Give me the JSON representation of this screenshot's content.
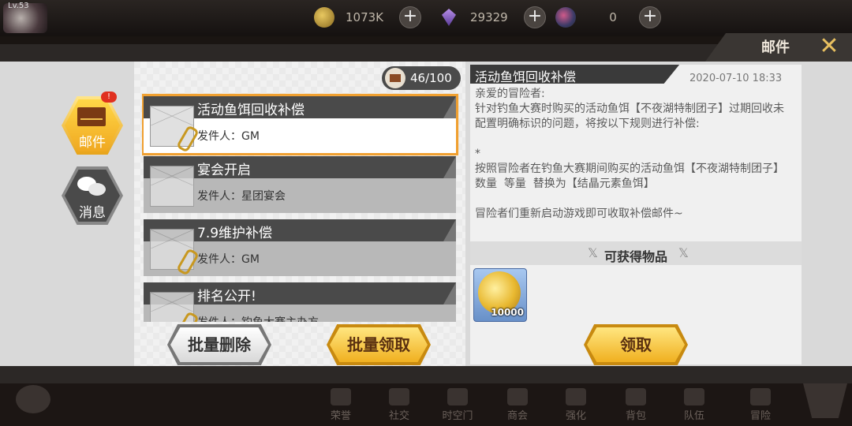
{
  "top_bar": {
    "level": "Lv.53",
    "currencies": [
      {
        "icon": "gold-coin-icon",
        "value": "1073K"
      },
      {
        "icon": "gem-icon",
        "value": "29329"
      },
      {
        "icon": "orb-icon",
        "value": "0"
      }
    ]
  },
  "header": {
    "title": "邮件",
    "close_icon": "close-x-icon"
  },
  "sidebar": {
    "mail_label": "邮件",
    "mail_badge": "!",
    "message_label": "消息"
  },
  "mail_counter": "46/100",
  "mail_list": [
    {
      "subject": "活动鱼饵回收补偿",
      "sender": "发件人：GM",
      "selected": true,
      "attachment": true
    },
    {
      "subject": "宴会开启",
      "sender": "发件人：星团宴会",
      "selected": false,
      "attachment": false
    },
    {
      "subject": "7.9维护补偿",
      "sender": "发件人：GM",
      "selected": false,
      "attachment": true
    },
    {
      "subject": "排名公开!",
      "sender": "发件人：钓鱼大赛主办方",
      "selected": false,
      "attachment": true
    }
  ],
  "buttons": {
    "delete_all": "批量删除",
    "claim_all": "批量领取",
    "claim": "领取"
  },
  "detail": {
    "title": "活动鱼饵回收补偿",
    "date": "2020-07-10 18:33",
    "body": "亲爱的冒险者:\n针对钓鱼大赛时购买的活动鱼饵【不夜湖特制团子】过期回收未配置明确标识的问题，将按以下规则进行补偿:\n\n*\n按照冒险者在钓鱼大赛期间购买的活动鱼饵【不夜湖特制团子】数量  等量  替换为【结晶元素鱼饵】\n\n冒险者们重新启动游戏即可收取补偿邮件~",
    "rewards_title": "可获得物品",
    "reward": {
      "icon": "gold-coin-icon",
      "quantity": "10000"
    }
  },
  "bottom_nav": [
    {
      "label": "荣誉",
      "icon": "honor-icon"
    },
    {
      "label": "社交",
      "icon": "social-icon"
    },
    {
      "label": "时空门",
      "icon": "portal-icon"
    },
    {
      "label": "商会",
      "icon": "shop-icon"
    },
    {
      "label": "强化",
      "icon": "enhance-icon"
    },
    {
      "label": "背包",
      "icon": "bag-icon"
    },
    {
      "label": "队伍",
      "icon": "team-icon"
    },
    {
      "label": "冒险",
      "icon": "adventure-icon"
    }
  ]
}
